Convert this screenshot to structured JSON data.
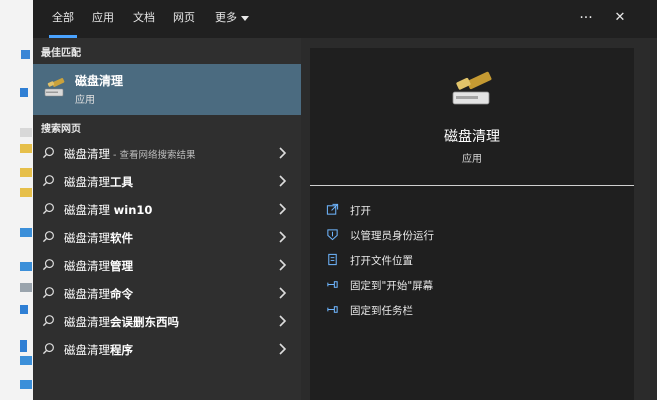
{
  "tabs": [
    {
      "label": "全部",
      "active": true
    },
    {
      "label": "应用",
      "active": false
    },
    {
      "label": "文档",
      "active": false
    },
    {
      "label": "网页",
      "active": false
    },
    {
      "label": "更多",
      "active": false
    }
  ],
  "topbar": {
    "more_options": "···",
    "close": "✕"
  },
  "best_match": {
    "section_title": "最佳匹配",
    "name": "磁盘清理",
    "type": "应用",
    "icon": "disk-cleanup-icon"
  },
  "web_search": {
    "section_title": "搜索网页",
    "items": [
      {
        "query": "磁盘清理",
        "suffix": " - 查看网络搜索结果"
      },
      {
        "query": "磁盘清理",
        "bold_suffix": "工具"
      },
      {
        "query": "磁盘清理 ",
        "bold_suffix": "win10"
      },
      {
        "query": "磁盘清理",
        "bold_suffix": "软件"
      },
      {
        "query": "磁盘清理",
        "bold_suffix": "管理"
      },
      {
        "query": "磁盘清理",
        "bold_suffix": "命令"
      },
      {
        "query": "磁盘清理",
        "bold_suffix": "会误删东西吗"
      },
      {
        "query": "磁盘清理",
        "bold_suffix": "程序"
      }
    ]
  },
  "detail": {
    "title": "磁盘清理",
    "type": "应用",
    "actions": [
      {
        "label": "打开",
        "icon": "open-icon"
      },
      {
        "label": "以管理员身份运行",
        "icon": "run-as-admin-icon"
      },
      {
        "label": "打开文件位置",
        "icon": "file-location-icon"
      },
      {
        "label": "固定到\"开始\"屏幕",
        "icon": "pin-start-icon"
      },
      {
        "label": "固定到任务栏",
        "icon": "pin-taskbar-icon"
      }
    ]
  },
  "colors": {
    "accent": "#4aa3ff",
    "selected": "#4b6b80",
    "panel": "#2f2f2f",
    "detail": "#1f1f1f"
  }
}
